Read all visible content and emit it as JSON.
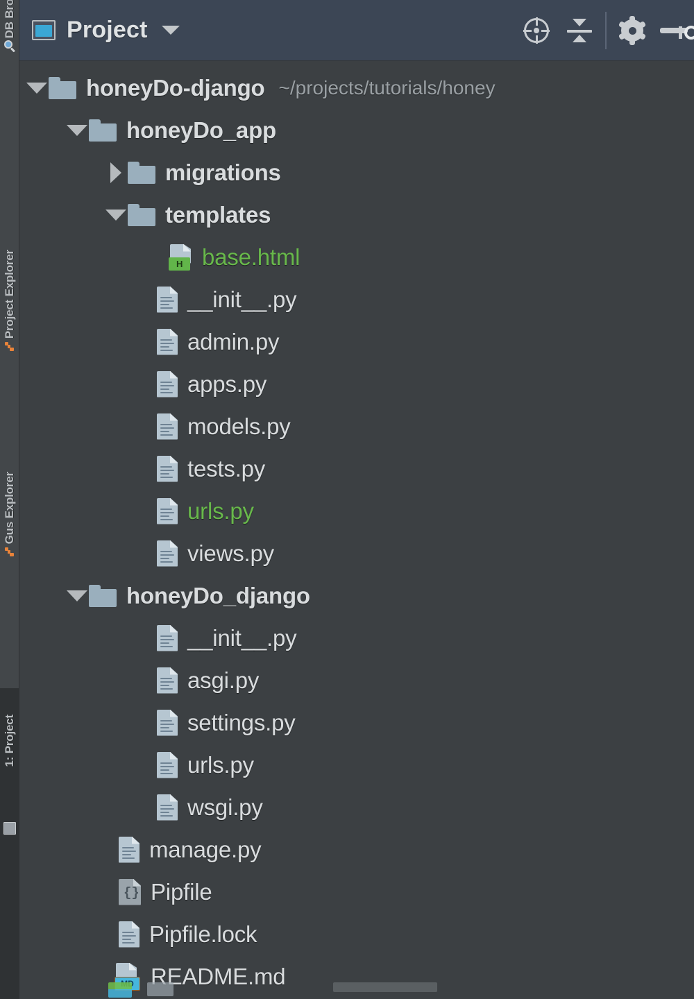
{
  "header": {
    "title": "Project",
    "window_icon": "project-window-icon",
    "dropdown_icon": "chevron-down-icon",
    "actions": [
      {
        "name": "locate-icon",
        "label": "Select Opened File"
      },
      {
        "name": "collapse-all-icon",
        "label": "Collapse All"
      },
      {
        "name": "gear-icon",
        "label": "Settings"
      },
      {
        "name": "minimize-icon",
        "label": "Hide"
      }
    ]
  },
  "side_tabs": [
    {
      "label": "DB Browser",
      "icon": "magnifier-icon"
    },
    {
      "label": "Project Explorer",
      "icon": "branch-icon"
    },
    {
      "label": "Gus Explorer",
      "icon": "branch-icon"
    },
    {
      "label": "1: Project",
      "icon": "panel-icon"
    }
  ],
  "tree": {
    "root_path": "~/projects/tutorials/honey",
    "rows": [
      {
        "label": "honeyDo-django",
        "type": "folder",
        "state": "expanded",
        "depth": 0,
        "bold": true,
        "color": "default",
        "path": "~/projects/tutorials/honey"
      },
      {
        "label": "honeyDo_app",
        "type": "folder",
        "state": "expanded",
        "depth": 1,
        "bold": true,
        "color": "default"
      },
      {
        "label": "migrations",
        "type": "folder",
        "state": "collapsed",
        "depth": 2,
        "bold": true,
        "color": "default"
      },
      {
        "label": "templates",
        "type": "folder",
        "state": "expanded",
        "depth": 2,
        "bold": true,
        "color": "default"
      },
      {
        "label": "base.html",
        "type": "html",
        "state": "leaf",
        "depth": 3,
        "bold": false,
        "color": "green",
        "badge": "H"
      },
      {
        "label": "__init__.py",
        "type": "python",
        "state": "leaf",
        "depth": 2,
        "bold": false,
        "color": "default"
      },
      {
        "label": "admin.py",
        "type": "python",
        "state": "leaf",
        "depth": 2,
        "bold": false,
        "color": "default"
      },
      {
        "label": "apps.py",
        "type": "python",
        "state": "leaf",
        "depth": 2,
        "bold": false,
        "color": "default"
      },
      {
        "label": "models.py",
        "type": "python",
        "state": "leaf",
        "depth": 2,
        "bold": false,
        "color": "default"
      },
      {
        "label": "tests.py",
        "type": "python",
        "state": "leaf",
        "depth": 2,
        "bold": false,
        "color": "default"
      },
      {
        "label": "urls.py",
        "type": "python",
        "state": "leaf",
        "depth": 2,
        "bold": false,
        "color": "green"
      },
      {
        "label": "views.py",
        "type": "python",
        "state": "leaf",
        "depth": 2,
        "bold": false,
        "color": "default"
      },
      {
        "label": "honeyDo_django",
        "type": "folder",
        "state": "expanded",
        "depth": 1,
        "bold": true,
        "color": "default"
      },
      {
        "label": "__init__.py",
        "type": "python",
        "state": "leaf",
        "depth": 2,
        "bold": false,
        "color": "default"
      },
      {
        "label": "asgi.py",
        "type": "python",
        "state": "leaf",
        "depth": 2,
        "bold": false,
        "color": "default"
      },
      {
        "label": "settings.py",
        "type": "python",
        "state": "leaf",
        "depth": 2,
        "bold": false,
        "color": "default"
      },
      {
        "label": "urls.py",
        "type": "python",
        "state": "leaf",
        "depth": 2,
        "bold": false,
        "color": "default"
      },
      {
        "label": "wsgi.py",
        "type": "python",
        "state": "leaf",
        "depth": 2,
        "bold": false,
        "color": "default"
      },
      {
        "label": "manage.py",
        "type": "python",
        "state": "leaf",
        "depth": 1,
        "bold": false,
        "color": "default"
      },
      {
        "label": "Pipfile",
        "type": "pipfile",
        "state": "leaf",
        "depth": 1,
        "bold": false,
        "color": "default"
      },
      {
        "label": "Pipfile.lock",
        "type": "python",
        "state": "leaf",
        "depth": 1,
        "bold": false,
        "color": "default"
      },
      {
        "label": "README.md",
        "type": "markdown",
        "state": "leaf",
        "depth": 1,
        "bold": false,
        "color": "default",
        "badge": "MD"
      }
    ]
  },
  "colors": {
    "panel_bg": "#3c4043",
    "header_bg": "#3c4655",
    "text": "#d9dcde",
    "muted_text": "#9aa0a4",
    "green_file": "#68b84b",
    "folder": "#9aafbd",
    "accent_cyan": "#46b6dd",
    "accent_orange": "#e8833a"
  }
}
